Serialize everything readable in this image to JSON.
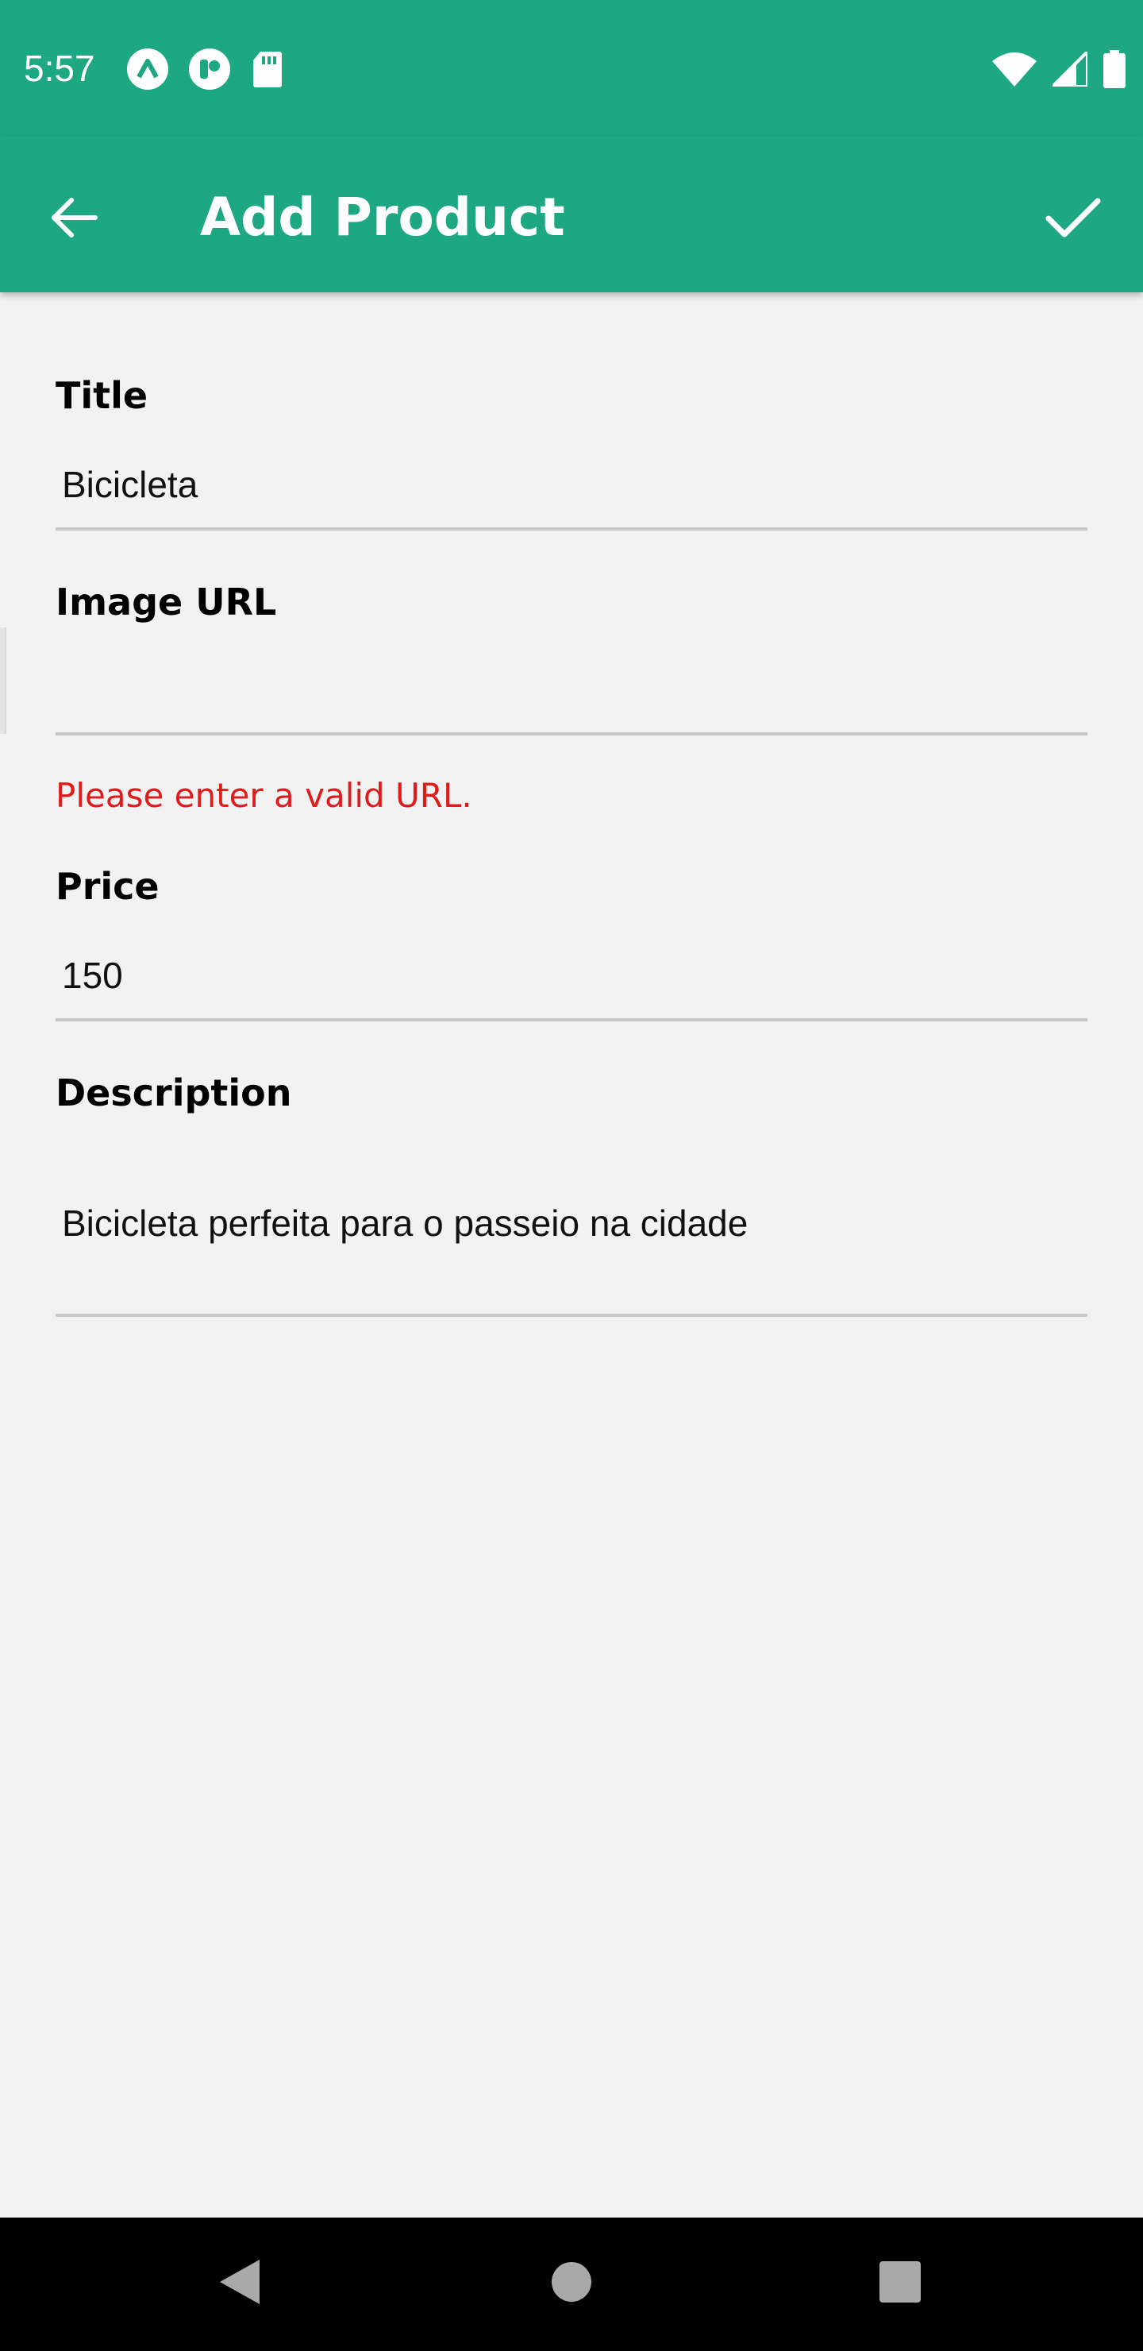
{
  "status_bar": {
    "time": "5:57",
    "left_icons": [
      "expo-icon",
      "app-notification-icon",
      "sd-card-icon"
    ],
    "right_icons": [
      "wifi-icon",
      "cell-signal-icon",
      "battery-icon"
    ]
  },
  "app_bar": {
    "title": "Add Product",
    "back_icon": "arrow-back-icon",
    "save_icon": "checkmark-icon",
    "background": "#1ea783"
  },
  "form": {
    "title": {
      "label": "Title",
      "value": "Bicicleta"
    },
    "image_url": {
      "label": "Image URL",
      "value": "",
      "error": "Please enter a valid URL.",
      "error_color": "#e01b1b"
    },
    "price": {
      "label": "Price",
      "value": "150"
    },
    "description": {
      "label": "Description",
      "value": "Bicicleta perfeita para o passeio na cidade"
    }
  },
  "nav_bar": {
    "buttons": [
      "nav-back-icon",
      "nav-home-icon",
      "nav-recents-icon"
    ]
  }
}
